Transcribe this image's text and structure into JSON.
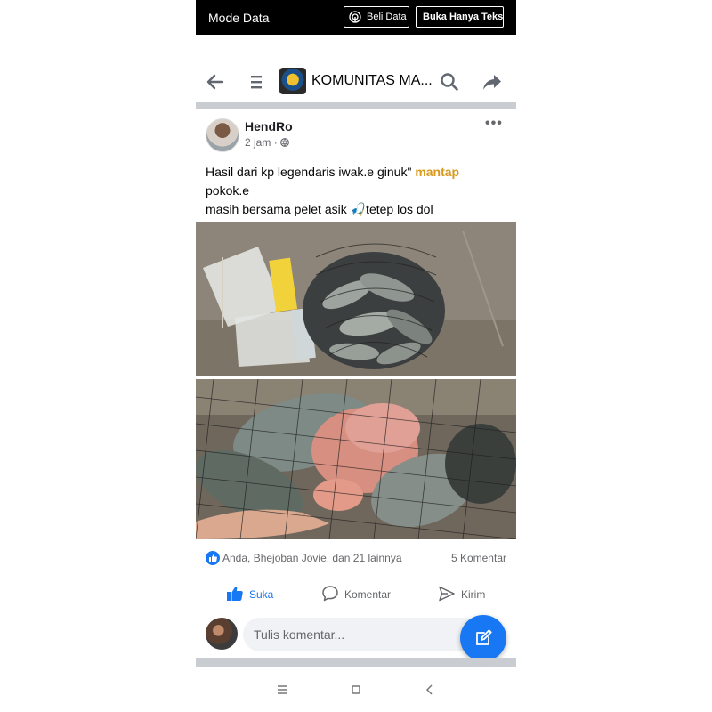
{
  "data_bar": {
    "label": "Mode Data",
    "buy_button": "Beli Data",
    "text_only_button": "Buka Hanya Teks"
  },
  "header": {
    "group_name": "KOMUNITAS MA...",
    "icons": [
      "back-arrow-icon",
      "menu-icon",
      "search-icon",
      "share-icon"
    ]
  },
  "post": {
    "author": "HendRo",
    "time": "2 jam",
    "privacy_icon": "public-globe-icon",
    "text_line1_prefix": "Hasil dari kp legendaris iwak.e ginuk\" ",
    "text_line1_highlight": "mantap",
    "text_line2": "pokok.e",
    "text_line3": "masih bersama pelet asik 🎣tetep los dol",
    "reactions": "Anda, Bhejoban Jovie, dan 21 lainnya",
    "comments_count": "5 Komentar",
    "actions": {
      "like": "Suka",
      "comment": "Komentar",
      "send": "Kirim"
    }
  },
  "comment_box": {
    "placeholder": "Tulis komentar..."
  },
  "colors": {
    "accent": "#1877f2",
    "highlight": "#d99a1c",
    "separator": "#c9ccd1"
  }
}
